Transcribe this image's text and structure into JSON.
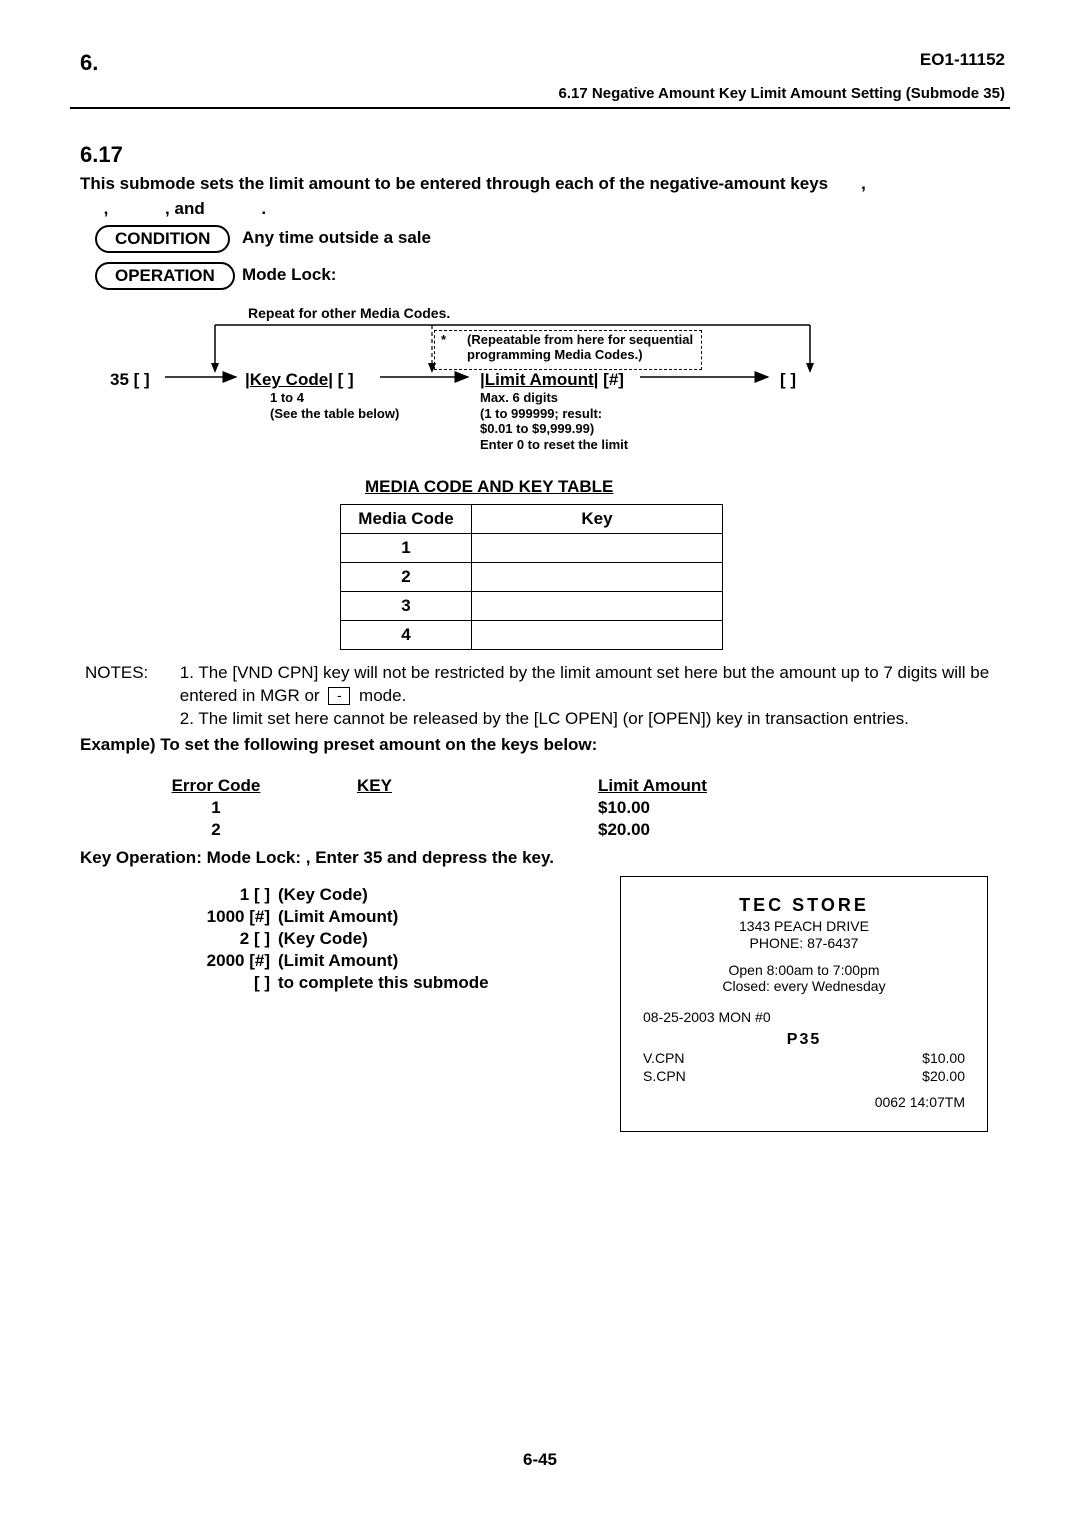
{
  "header": {
    "left": "6.   ",
    "doc_id": "EO1-11152",
    "subtitle": "6.17 Negative Amount Key Limit Amount Setting (Submode 35)"
  },
  "section_num": "6.17",
  "section_title_rest": "Negative Amount Key Limit Amount Setting (Submode 35)",
  "intro_line1": "This submode sets the limit amount to be entered through each of the negative-amount keys",
  "intro_keys_tail": ",",
  "intro_line2_mid": ",",
  "intro_line2_and": ", and",
  "intro_line2_end": ".",
  "condition_label": "CONDITION",
  "condition_text": "Any time outside a sale",
  "operation_label": "OPERATION",
  "operation_text": "Mode Lock:",
  "diagram": {
    "repeat": "Repeat for other Media Codes.",
    "note": "(Repeatable from here for sequential programming Media Codes.)",
    "step1": "35 [",
    "step1_key": "]",
    "step2_label": "Key Code",
    "step2_key": "[   ]",
    "step2_sub1": "1 to 4",
    "step2_sub2": "(See the table below)",
    "step3_label": "Limit Amount",
    "step3_key": "[#]",
    "step3_sub": "Max. 6 digits\n(1 to 999999; result:\n$0.01 to $9,999.99)\nEnter 0 to reset the limit",
    "step4_key": "[   ]"
  },
  "table_title": "MEDIA CODE AND KEY TABLE",
  "table": {
    "headers": [
      "Media Code",
      "Key"
    ],
    "rows": [
      [
        "1",
        ""
      ],
      [
        "2",
        ""
      ],
      [
        "3",
        ""
      ],
      [
        "4",
        ""
      ]
    ]
  },
  "notes_label": "NOTES:",
  "note1": "1.  The [VND CPN] key will not be restricted by the limit amount set here but the amount up to 7 digits will be entered in  MGR  or",
  "note1_tail": "mode.",
  "note2": "2.  The limit set here cannot be released by the [LC OPEN]  (or [OPEN]) key in transaction entries.",
  "example_title": "Example) To set the following preset amount on the keys below:",
  "example_headers": [
    "Error Code",
    "KEY",
    "Limit Amount"
  ],
  "example_rows": [
    [
      "1",
      "",
      "$10.00"
    ],
    [
      "2",
      "",
      "$20.00"
    ]
  ],
  "keyop_title": "Key Operation: Mode Lock:      , Enter 35 and depress the       key.",
  "keyop_steps": [
    [
      "1 [   ]",
      "(Key Code)"
    ],
    [
      "1000 [#]",
      "(Limit Amount)"
    ],
    [
      "2 [   ]",
      "(Key Code)"
    ],
    [
      "2000 [#]",
      "(Limit Amount)"
    ],
    [
      "[   ]",
      "to complete this submode"
    ]
  ],
  "receipt": {
    "store": "TEC STORE",
    "addr": "1343 PEACH DRIVE",
    "phone": "PHONE: 87-6437",
    "hours1": "Open  8:00am to 7:00pm",
    "hours2": "Closed: every Wednesday",
    "date": "08-25-2003 MON  #0",
    "mode": "P35",
    "lines": [
      {
        "l": "V.CPN",
        "r": "$10.00"
      },
      {
        "l": "S.CPN",
        "r": "$20.00"
      }
    ],
    "tm": "0062 14:07TM"
  },
  "page_num": "6-45",
  "chart_data": {
    "type": "table",
    "title": "MEDIA CODE AND KEY TABLE",
    "columns": [
      "Media Code",
      "Key"
    ],
    "rows": [
      {
        "Media Code": 1,
        "Key": ""
      },
      {
        "Media Code": 2,
        "Key": ""
      },
      {
        "Media Code": 3,
        "Key": ""
      },
      {
        "Media Code": 4,
        "Key": ""
      }
    ]
  }
}
